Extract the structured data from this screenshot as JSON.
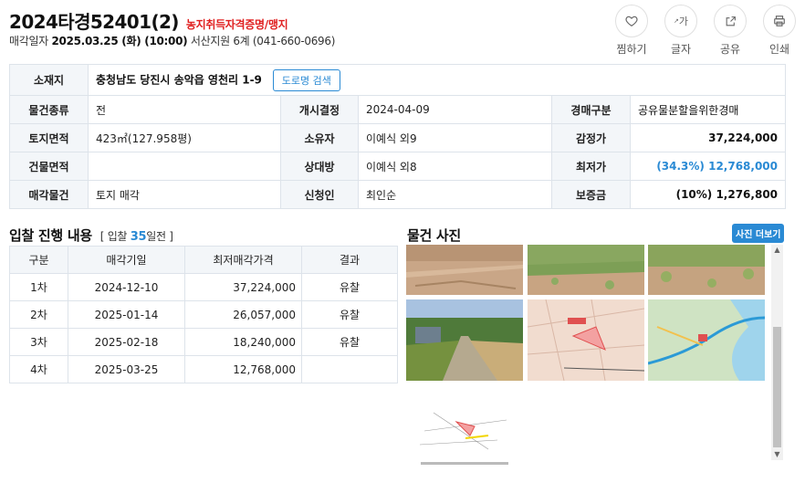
{
  "header": {
    "case_no": "2024타경52401(2)",
    "tag": "농지취득자격증명/맹지",
    "date_label": "매각일자",
    "date_value": "2025.03.25 (화) (10:00)",
    "court": "서산지원 6계 (041-660-0696)"
  },
  "actions": [
    {
      "label": "찜하기",
      "icon": "heart-icon"
    },
    {
      "label": "글자",
      "icon": "font-size-icon"
    },
    {
      "label": "공유",
      "icon": "share-icon"
    },
    {
      "label": "인쇄",
      "icon": "print-icon"
    }
  ],
  "info": {
    "location_label": "소재지",
    "location_value": "충청남도 당진시 송악읍 영천리 1-9",
    "road_search_button": "도로명 검색",
    "rows": [
      {
        "l1": "물건종류",
        "v1": "전",
        "l2": "개시결정",
        "v2": "2024-04-09",
        "l3": "경매구분",
        "v3": "공유물분할을위한경매"
      },
      {
        "l1": "토지면적",
        "v1": "423㎡(127.958평)",
        "l2": "소유자",
        "v2": "이예식 외9",
        "l3": "감정가",
        "v3": "37,224,000"
      },
      {
        "l1": "건물면적",
        "v1": "",
        "l2": "상대방",
        "v2": "이예식 외8",
        "l3": "최저가",
        "v3": "(34.3%) 12,768,000"
      },
      {
        "l1": "매각물건",
        "v1": "토지 매각",
        "l2": "신청인",
        "v2": "최인순",
        "l3": "보증금",
        "v3": "(10%) 1,276,800"
      }
    ]
  },
  "bids": {
    "title": "입찰 진행 내용",
    "meta_prefix": "[ 입찰",
    "meta_days": "35",
    "meta_suffix": "일전 ]",
    "headers": [
      "구분",
      "매각기일",
      "최저매각가격",
      "결과"
    ],
    "rows": [
      [
        "1차",
        "2024-12-10",
        "37,224,000",
        "유찰"
      ],
      [
        "2차",
        "2025-01-14",
        "26,057,000",
        "유찰"
      ],
      [
        "3차",
        "2025-02-18",
        "18,240,000",
        "유찰"
      ],
      [
        "4차",
        "2025-03-25",
        "12,768,000",
        ""
      ]
    ]
  },
  "photos": {
    "title": "물건 사진",
    "more_button": "사진 더보기"
  },
  "colors": {
    "accent": "#2a8ad4",
    "tag_red": "#e02020",
    "header_bg": "#f3f6f9",
    "border": "#dde3ea"
  }
}
